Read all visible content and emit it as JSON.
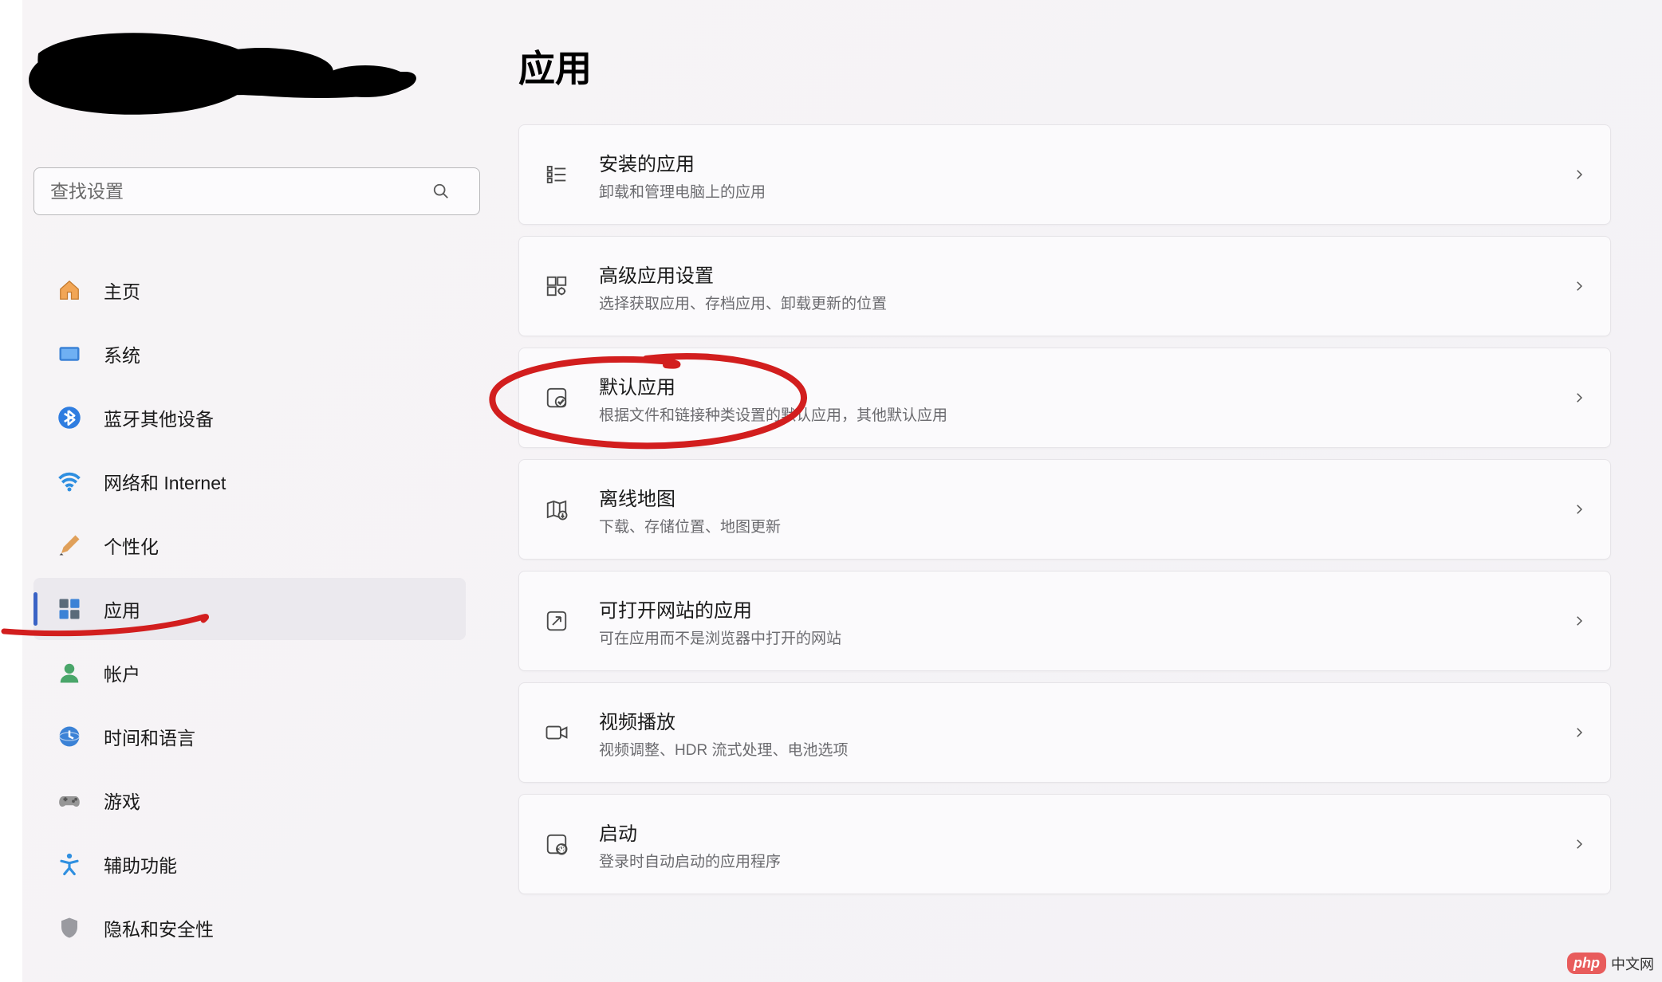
{
  "sidebar": {
    "search_placeholder": "查找设置",
    "items": [
      {
        "label": "主页",
        "icon": "home-icon"
      },
      {
        "label": "系统",
        "icon": "system-icon"
      },
      {
        "label": "蓝牙其他设备",
        "icon": "bluetooth-icon"
      },
      {
        "label": "网络和 Internet",
        "icon": "network-icon"
      },
      {
        "label": "个性化",
        "icon": "personalize-icon"
      },
      {
        "label": "应用",
        "icon": "apps-icon",
        "selected": true
      },
      {
        "label": "帐户",
        "icon": "accounts-icon"
      },
      {
        "label": "时间和语言",
        "icon": "time-icon"
      },
      {
        "label": "游戏",
        "icon": "gaming-icon"
      },
      {
        "label": "辅助功能",
        "icon": "accessibility-icon"
      },
      {
        "label": "隐私和安全性",
        "icon": "privacy-icon"
      }
    ]
  },
  "main": {
    "title": "应用",
    "cards": [
      {
        "title": "安装的应用",
        "desc": "卸载和管理电脑上的应用",
        "icon": "installed-apps-icon"
      },
      {
        "title": "高级应用设置",
        "desc": "选择获取应用、存档应用、卸载更新的位置",
        "icon": "advanced-settings-icon"
      },
      {
        "title": "默认应用",
        "desc": "根据文件和链接种类设置的默认应用，其他默认应用",
        "icon": "default-apps-icon"
      },
      {
        "title": "离线地图",
        "desc": "下载、存储位置、地图更新",
        "icon": "maps-icon"
      },
      {
        "title": "可打开网站的应用",
        "desc": "可在应用而不是浏览器中打开的网站",
        "icon": "websites-icon"
      },
      {
        "title": "视频播放",
        "desc": "视频调整、HDR 流式处理、电池选项",
        "icon": "video-icon"
      },
      {
        "title": "启动",
        "desc": "登录时自动启动的应用程序",
        "icon": "startup-icon"
      }
    ]
  },
  "watermark": {
    "php": "php",
    "cn": "中文网"
  }
}
